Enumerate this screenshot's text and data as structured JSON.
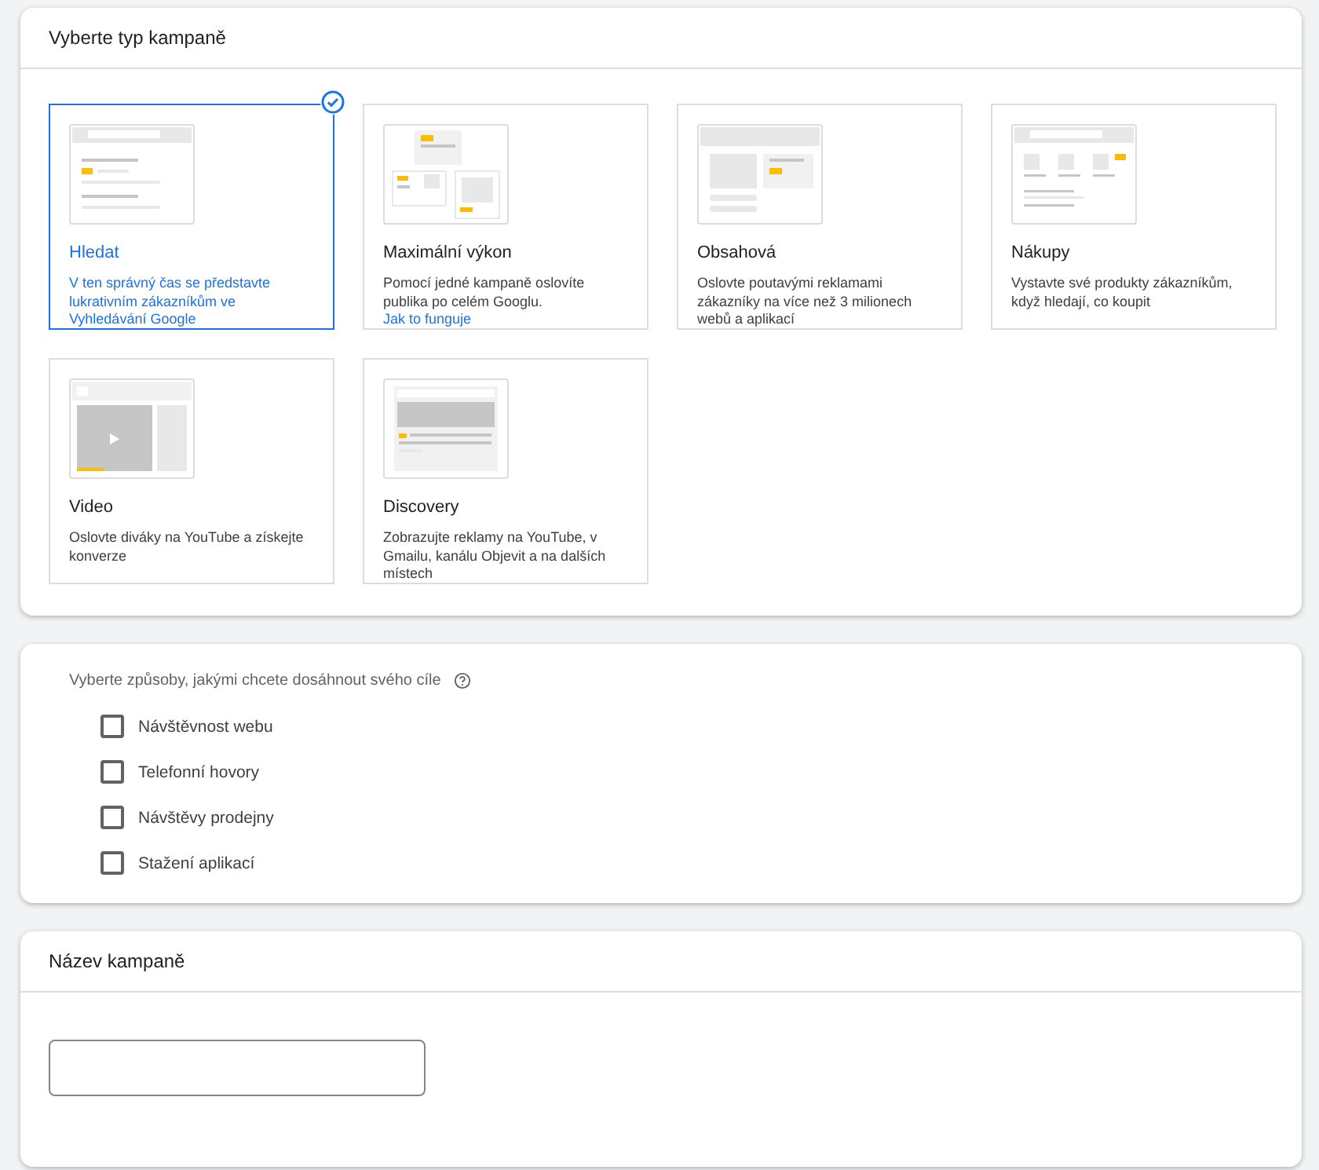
{
  "campaign_type": {
    "title": "Vyberte typ kampaně",
    "types": [
      {
        "kind": "search",
        "name": "Hledat",
        "description": "V ten správný čas se představte lukrativním zákazníkům ve Vyhledávání Google",
        "selected": true
      },
      {
        "kind": "performance",
        "name": "Maximální výkon",
        "description": "Pomocí jedné kampaně oslovíte publika po celém Googlu.",
        "link": "Jak to funguje",
        "selected": false
      },
      {
        "kind": "display",
        "name": "Obsahová",
        "description": "Oslovte poutavými reklamami zákazníky na více než 3 milionech webů a aplikací",
        "selected": false
      },
      {
        "kind": "shopping",
        "name": "Nákupy",
        "description": "Vystavte své produkty zákazníkům, když hledají, co koupit",
        "selected": false
      },
      {
        "kind": "video",
        "name": "Video",
        "description": "Oslovte diváky na YouTube a získejte konverze",
        "selected": false
      },
      {
        "kind": "discovery",
        "name": "Discovery",
        "description": "Zobrazujte reklamy na YouTube, v Gmailu, kanálu Objevit a na dalších místech",
        "selected": false
      }
    ]
  },
  "goals": {
    "label": "Vyberte způsoby, jakými chcete dosáhnout svého cíle",
    "options": [
      {
        "label": "Návštěvnost webu",
        "checked": false
      },
      {
        "label": "Telefonní hovory",
        "checked": false
      },
      {
        "label": "Návštěvy prodejny",
        "checked": false
      },
      {
        "label": "Stažení aplikací",
        "checked": false
      }
    ]
  },
  "campaign_name": {
    "title": "Název kampaně"
  }
}
